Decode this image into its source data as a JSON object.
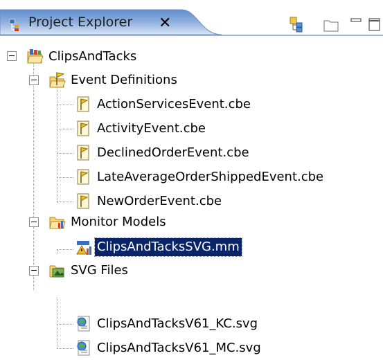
{
  "view": {
    "title": "Project Explorer",
    "close_glyph": "✕",
    "toolbar": [
      {
        "name": "link-with-editor-icon"
      },
      {
        "name": "folder-icon"
      },
      {
        "name": "minimize-icon"
      },
      {
        "name": "maximize-icon"
      }
    ]
  },
  "tree": {
    "project": {
      "label": "ClipsAndTacks",
      "icon": "project-folder-icon",
      "expanded": true
    },
    "event_definitions": {
      "label": "Event Definitions",
      "icon": "event-definitions-folder-icon",
      "expanded": true,
      "items": [
        {
          "label": "ActionServicesEvent.cbe",
          "icon": "cbe-file-icon"
        },
        {
          "label": "ActivityEvent.cbe",
          "icon": "cbe-file-icon"
        },
        {
          "label": "DeclinedOrderEvent.cbe",
          "icon": "cbe-file-icon"
        },
        {
          "label": "LateAverageOrderShippedEvent.cbe",
          "icon": "cbe-file-icon"
        },
        {
          "label": "NewOrderEvent.cbe",
          "icon": "cbe-file-icon"
        }
      ]
    },
    "monitor_models": {
      "label": "Monitor Models",
      "icon": "monitor-models-folder-icon",
      "expanded": true,
      "items": [
        {
          "label": "ClipsAndTacksSVG.mm",
          "icon": "monitor-model-file-icon",
          "selected": true
        }
      ]
    },
    "svg_files": {
      "label": "SVG Files",
      "icon": "svg-files-folder-icon",
      "expanded": true,
      "items": [
        {
          "label": "ClipsAndTacksV61_KC.svg",
          "icon": "svg-file-icon"
        },
        {
          "label": "ClipsAndTacksV61_MC.svg",
          "icon": "svg-file-icon"
        }
      ]
    }
  },
  "colors": {
    "selection_bg": "#0a246a",
    "header_gradient_top": "#4f7fc4",
    "header_gradient_bottom": "#c3d4ec"
  }
}
